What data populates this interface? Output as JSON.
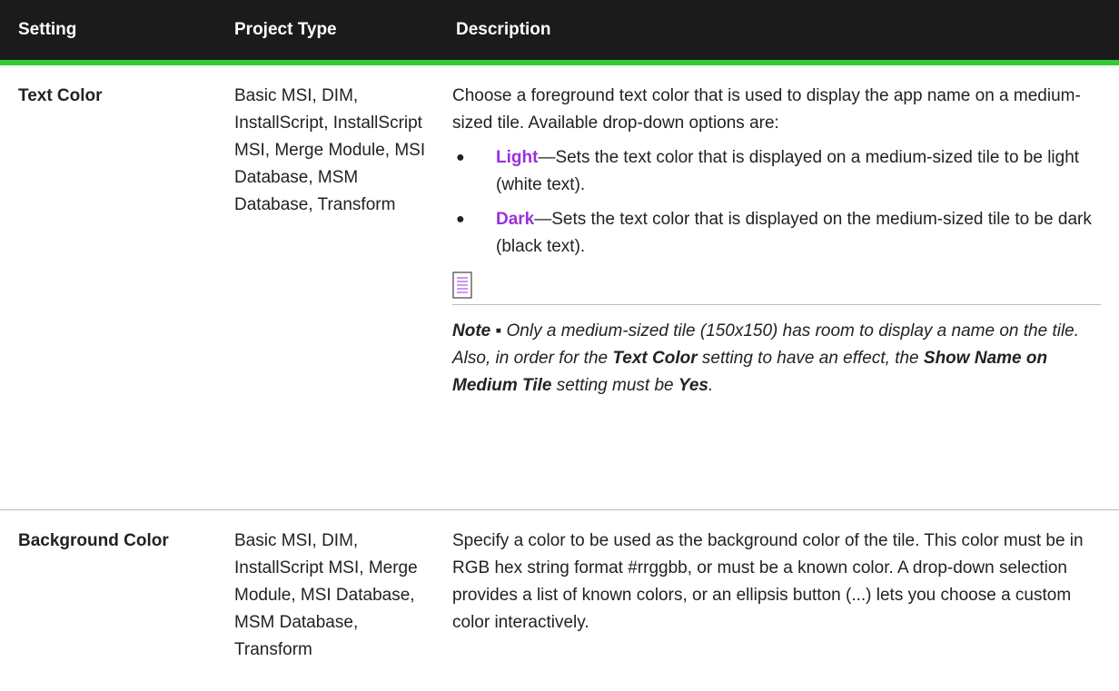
{
  "header": {
    "setting": "Setting",
    "project_type": "Project Type",
    "description": "Description"
  },
  "rows": [
    {
      "setting": "Text Color",
      "project_type": "Basic MSI, DIM, InstallScript, InstallScript MSI, Merge Module, MSI Database, MSM Database, Transform",
      "description": "Choose a foreground text color that is used to display the app name on a medium-sized tile. Available drop-down options are:",
      "options": [
        {
          "name": "Light",
          "text": "—Sets the text color that is displayed on a medium-sized tile to be light (white text)."
        },
        {
          "name": "Dark",
          "text": "—Sets the text color that is displayed on the medium-sized tile to be dark (black text)."
        }
      ],
      "note": {
        "icon": "note-icon",
        "label": "Note",
        "separator": " ▪ ",
        "text1": "Only a medium-sized tile (150x150) has room to display a name on the tile. Also, in order for the ",
        "bold1": "Text Color",
        "text2": " setting to have an effect, the ",
        "bold2": "Show Name on Medium Tile",
        "text3": " setting must be ",
        "bold3": "Yes",
        "text4": "."
      }
    },
    {
      "setting": "Background Color",
      "project_type": "Basic MSI, DIM, InstallScript MSI, Merge Module, MSI Database, MSM Database, Transform",
      "description": "Specify a color to be used as the background color of the tile. This color must be in RGB hex string format #rrggbb, or must be a known color. A drop-down selection provides a list of known colors, or an ellipsis button (...) lets you choose a custom color interactively."
    }
  ],
  "colors": {
    "header_bg": "#1b1b1b",
    "header_rule": "#33cc33",
    "keyword": "#9b30d9"
  }
}
